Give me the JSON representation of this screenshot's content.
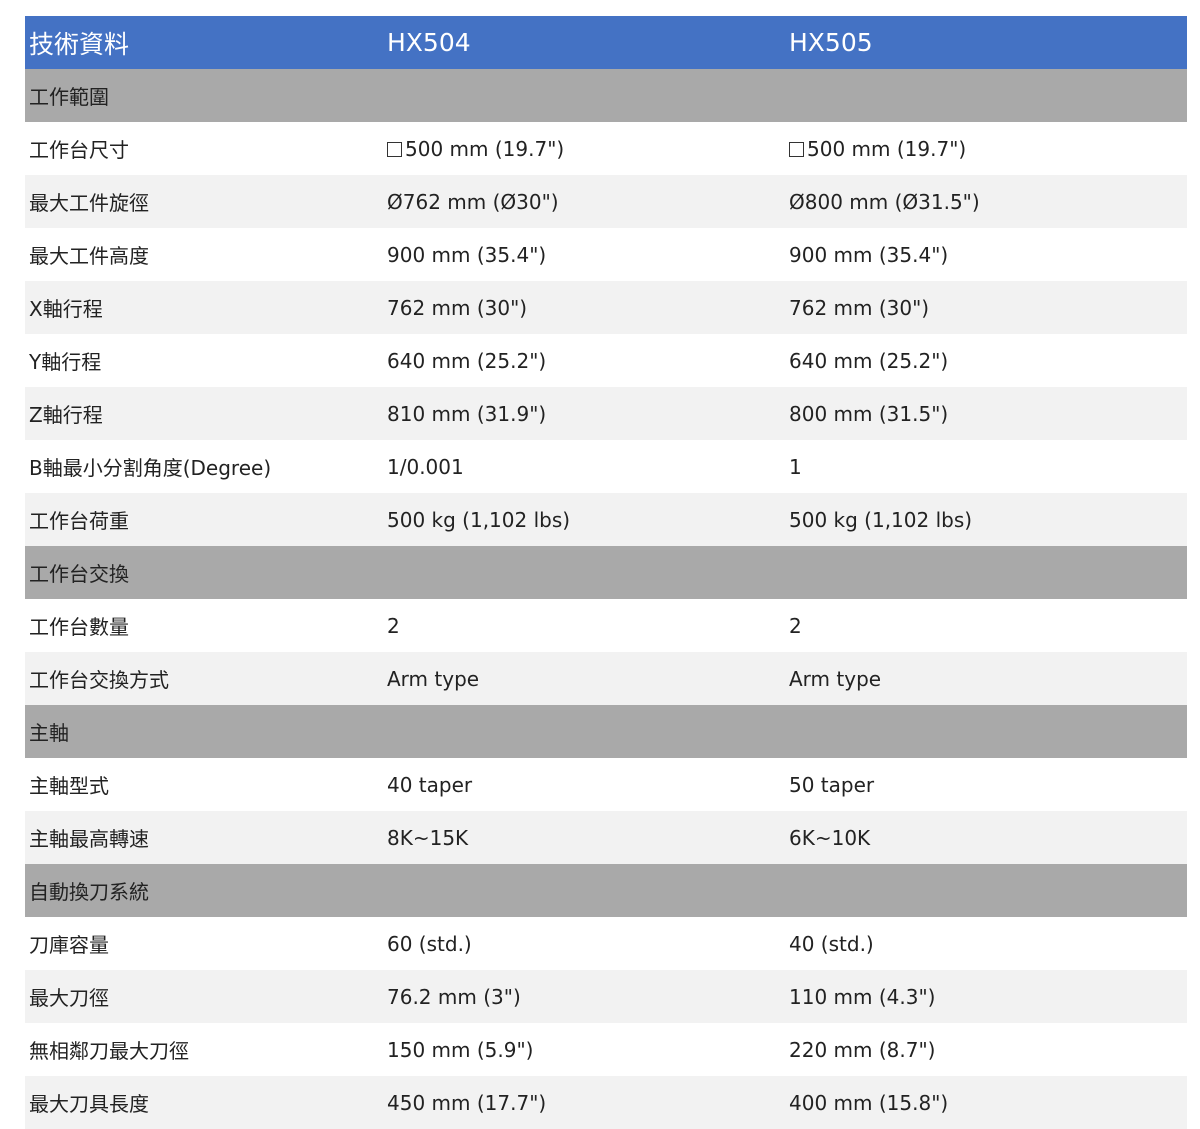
{
  "header": {
    "label": "技術資料",
    "model_a": "HX504",
    "model_b": "HX505"
  },
  "colors": {
    "header_bg": "#4472c4",
    "section_bg": "#a9a9a9",
    "stripe_bg": "#f2f2f2"
  },
  "sections": [
    {
      "title": "工作範圍",
      "rows": [
        {
          "label": "工作台尺寸",
          "a": "500 mm (19.7\")",
          "b": "500 mm (19.7\")",
          "icon": "square-icon"
        },
        {
          "label": "最大工件旋徑",
          "a": "Ø762 mm (Ø30\")",
          "b": "Ø800 mm (Ø31.5\")"
        },
        {
          "label": "最大工件高度",
          "a": "900 mm (35.4\")",
          "b": "900 mm (35.4\")"
        },
        {
          "label": "X軸行程",
          "a": "762 mm (30\")",
          "b": "762 mm (30\")"
        },
        {
          "label": "Y軸行程",
          "a": "640 mm (25.2\")",
          "b": "640 mm (25.2\")"
        },
        {
          "label": "Z軸行程",
          "a": "810 mm (31.9\")",
          "b": "800 mm (31.5\")"
        },
        {
          "label": "B軸最小分割角度(Degree)",
          "a": "1/0.001",
          "b": "1"
        },
        {
          "label": "工作台荷重",
          "a": "500 kg (1,102 lbs)",
          "b": "500 kg (1,102 lbs)"
        }
      ]
    },
    {
      "title": "工作台交換",
      "rows": [
        {
          "label": "工作台數量",
          "a": "2",
          "b": "2"
        },
        {
          "label": "工作台交換方式",
          "a": "Arm type",
          "b": "Arm type"
        }
      ]
    },
    {
      "title": "主軸",
      "rows": [
        {
          "label": "主軸型式",
          "a": "40 taper",
          "b": "50 taper"
        },
        {
          "label": "主軸最高轉速",
          "a": "8K~15K",
          "b": "6K~10K"
        }
      ]
    },
    {
      "title": "自動換刀系統",
      "rows": [
        {
          "label": "刀庫容量",
          "a": "60 (std.)",
          "b": "40 (std.)"
        },
        {
          "label": "最大刀徑",
          "a": "76.2 mm (3\")",
          "b": "110 mm (4.3\")"
        },
        {
          "label": "無相鄰刀最大刀徑",
          "a": "150 mm (5.9\")",
          "b": "220 mm (8.7\")"
        },
        {
          "label": "最大刀具長度",
          "a": "450 mm (17.7\")",
          "b": "400 mm (15.8\")"
        }
      ]
    }
  ]
}
